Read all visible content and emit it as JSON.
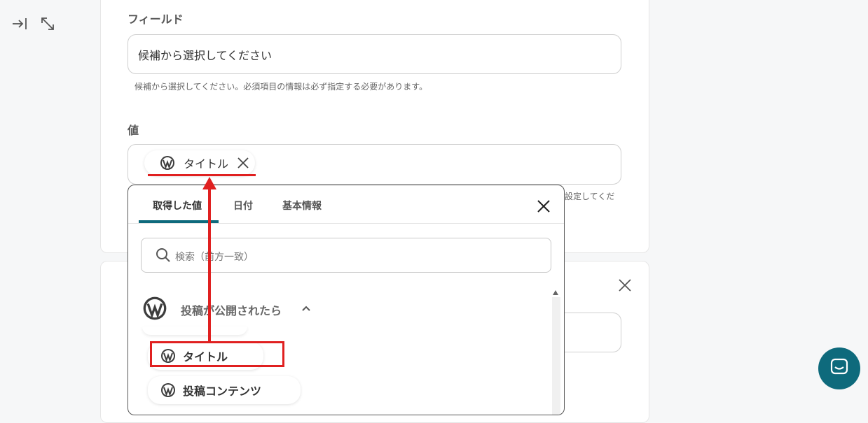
{
  "toolbar": {
    "collapse_icon": "arrow-right-to-bar-icon",
    "expand_icon": "diagonal-expand-icon"
  },
  "field_section": {
    "label": "フィールド",
    "placeholder": "候補から選択してください",
    "helper": "候補から選択してください。必須項目の情報は必ず指定する必要があります。"
  },
  "value_section": {
    "label": "値",
    "chip_label": "タイトル",
    "helper_fragment": "設定してくだ"
  },
  "panel": {
    "tabs": [
      {
        "label": "取得した値",
        "active": true
      },
      {
        "label": "日付",
        "active": false
      },
      {
        "label": "基本情報",
        "active": false
      }
    ],
    "search_placeholder": "検索（前方一致）",
    "group_title": "投稿が公開されたら",
    "items": [
      {
        "label": "タイトル",
        "highlighted": true
      },
      {
        "label": "投稿コンテンツ",
        "highlighted": false
      }
    ]
  },
  "colors": {
    "accent": "#0e6a7c",
    "highlight": "#e02020"
  }
}
